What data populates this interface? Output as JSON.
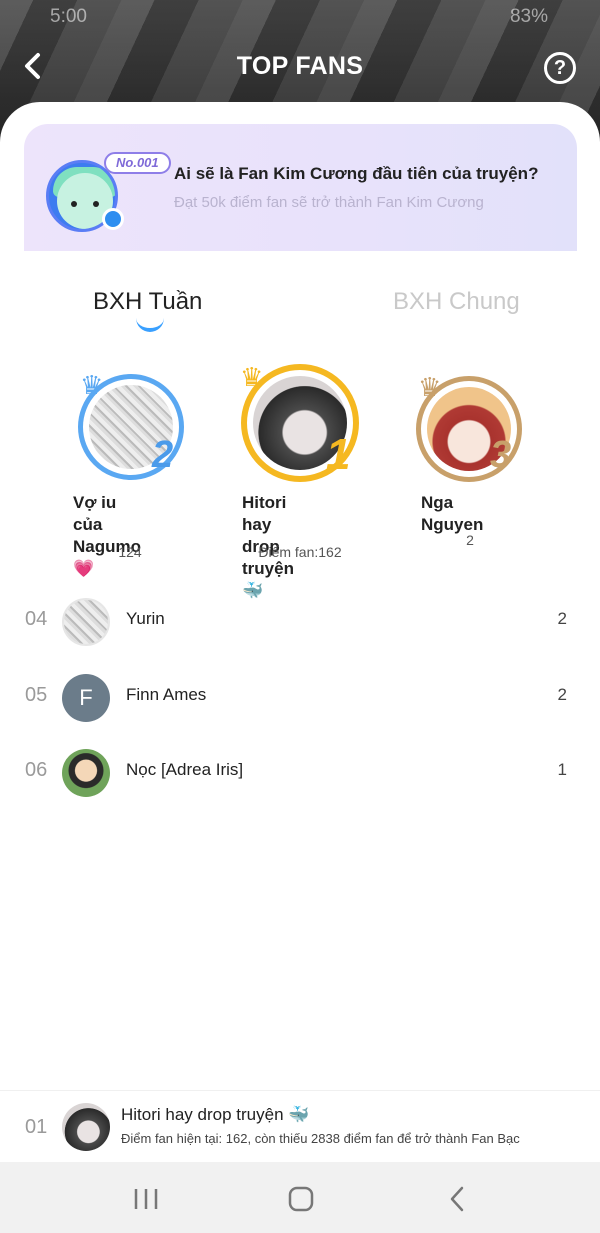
{
  "status": {
    "time": "5:00",
    "battery": "83%"
  },
  "header": {
    "title": "TOP FANS"
  },
  "banner": {
    "tag": "No.001",
    "title": "Ai sẽ là Fan Kim Cương đầu tiên của truyện?",
    "subtitle": "Đạt 50k điểm fan sẽ trở thành Fan Kim Cương"
  },
  "tabs": [
    {
      "label": "BXH Tuần",
      "active": true
    },
    {
      "label": "BXH Chung",
      "active": false
    }
  ],
  "podium": [
    {
      "rank": "2",
      "name_line1": "Vợ iu của",
      "name_line2": "Nagumo 💗",
      "score": "124"
    },
    {
      "rank": "1",
      "name_line1": "Hitori hay drop",
      "name_line2": "truyện 🐳",
      "score": "Điểm fan:162"
    },
    {
      "rank": "3",
      "name_line1": "Nga Nguyen",
      "name_line2": "",
      "score": "2"
    }
  ],
  "list": [
    {
      "rank": "04",
      "name": "Yurin",
      "score": "2"
    },
    {
      "rank": "05",
      "name": "Finn Ames",
      "initial": "F",
      "score": "2"
    },
    {
      "rank": "06",
      "name": "Nọc [Adrea Iris]",
      "score": "1"
    }
  ],
  "me": {
    "rank": "01",
    "name": "Hitori hay drop truyện 🐳",
    "desc": "Điểm fan hiện tại: 162, còn thiếu 2838 điểm fan để trở thành Fan Bạc"
  },
  "colors": {
    "accent": "#3aa0ff",
    "gold": "#f5b821",
    "silver": "#5aa8f2",
    "bronze": "#c8a06a"
  }
}
